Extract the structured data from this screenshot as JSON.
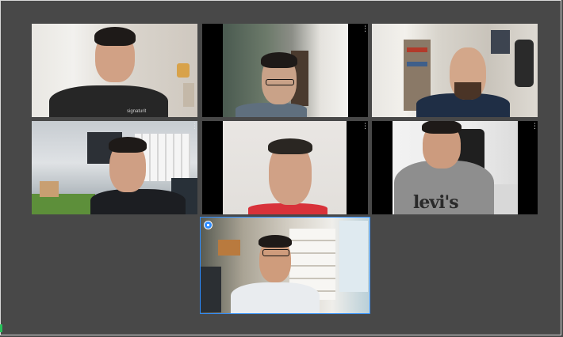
{
  "app": {
    "view": "gallery",
    "colors": {
      "background": "#484848",
      "active_speaker": "#2d8cff"
    }
  },
  "participants": [
    {
      "tile": "top-left",
      "shirt_logo": "signaturit",
      "more_icon": "more-vertical-icon"
    },
    {
      "tile": "top-center",
      "more_icon": "more-vertical-icon"
    },
    {
      "tile": "top-right",
      "more_icon": "more-vertical-icon"
    },
    {
      "tile": "middle-left",
      "more_icon": "more-vertical-icon"
    },
    {
      "tile": "middle-center",
      "more_icon": "more-vertical-icon"
    },
    {
      "tile": "middle-right",
      "shirt_print": "levi's",
      "more_icon": "more-vertical-icon"
    },
    {
      "tile": "bottom-center",
      "active_speaker": true,
      "badge_icon": "active-speaker-icon"
    }
  ],
  "ui": {
    "more_glyph": "⋮"
  }
}
